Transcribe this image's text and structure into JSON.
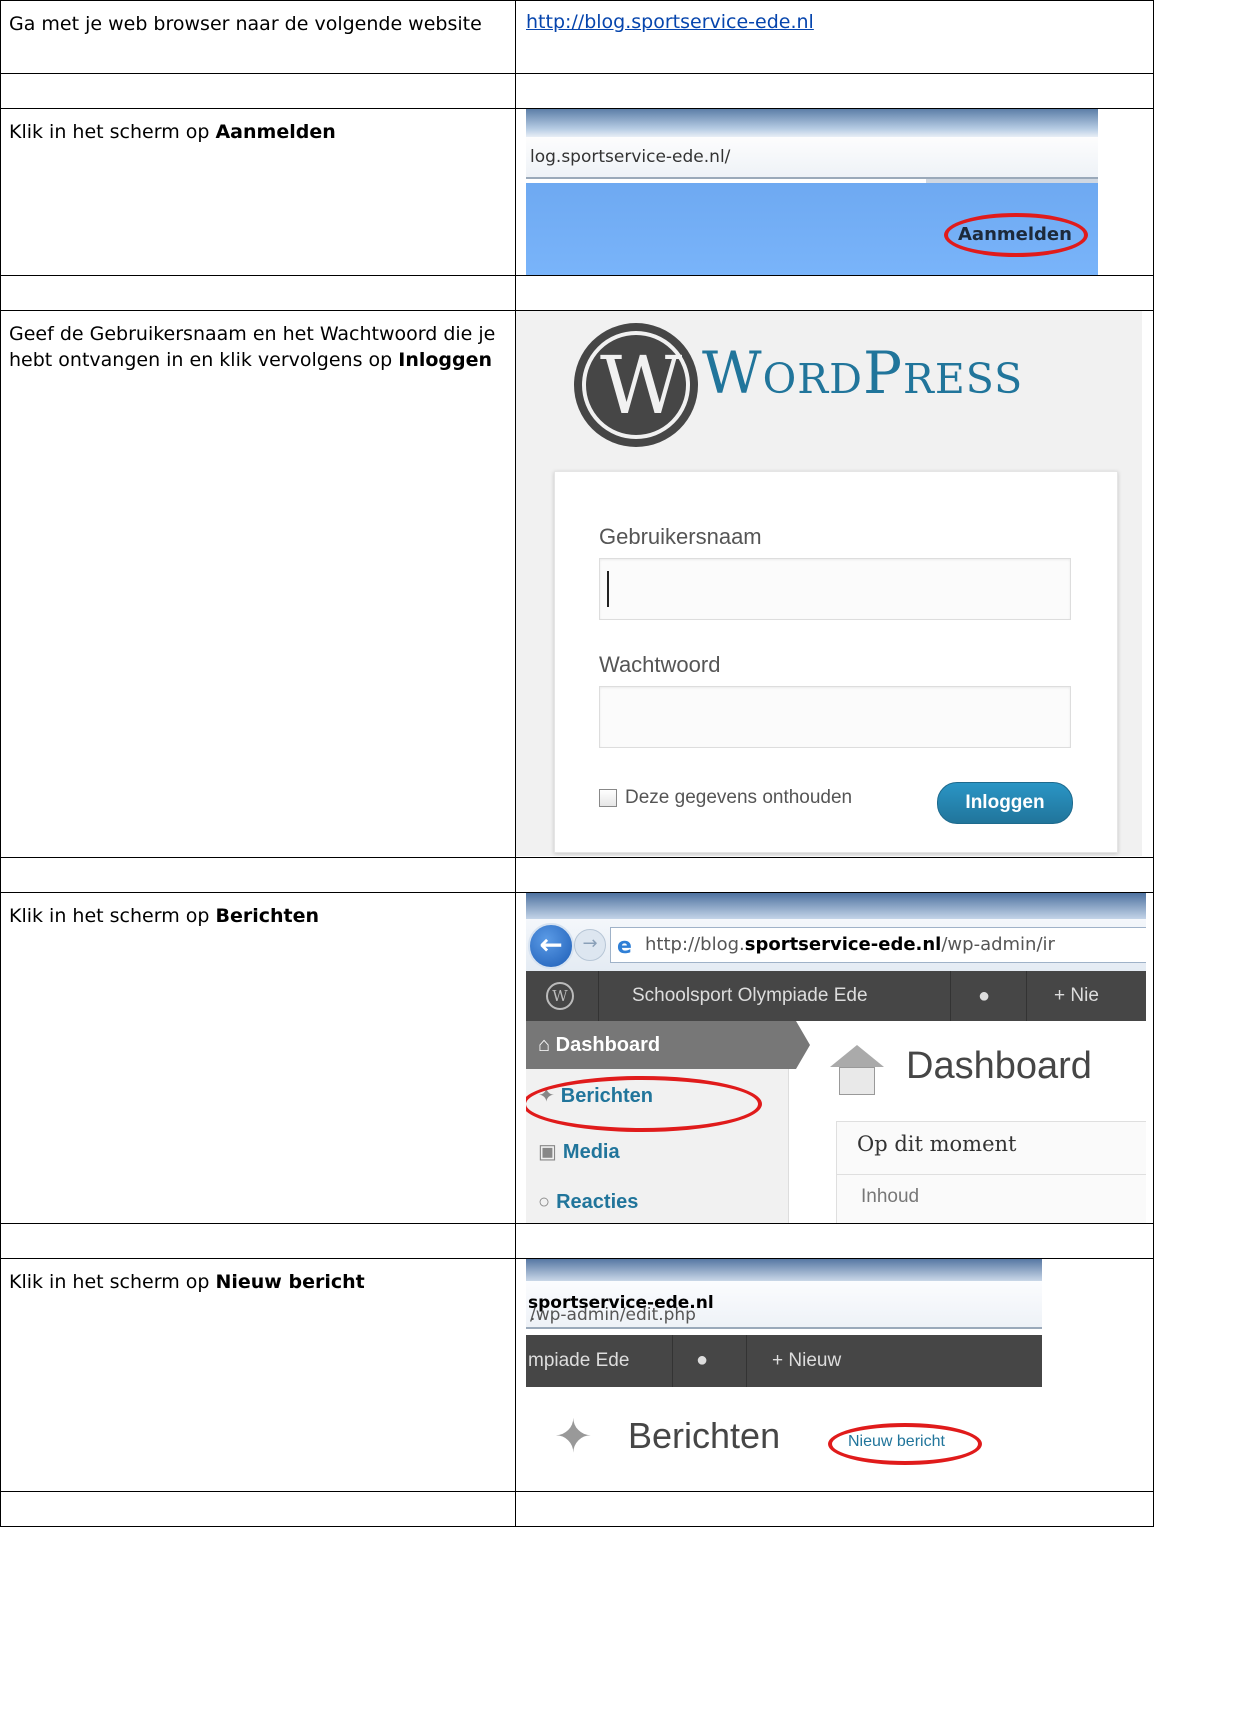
{
  "steps": [
    {
      "instruction_pre": "Ga met je web browser naar de volgende website",
      "link": "http://blog.sportservice-ede.nl"
    },
    {
      "instruction_pre": "Klik in het scherm op ",
      "instruction_bold": "Aanmelden",
      "screenshot": {
        "address_text": "log.sportservice-ede.nl/",
        "button_label": "Aanmelden"
      }
    },
    {
      "instruction_pre": "Geef de Gebruikersnaam en het Wachtwoord die je hebt ontvangen in en klik vervolgens op ",
      "instruction_bold": "Inloggen",
      "screenshot": {
        "logo_text": "WordPress",
        "username_label": "Gebruikersnaam",
        "password_label": "Wachtwoord",
        "remember_label": "Deze gegevens onthouden",
        "login_button": "Inloggen"
      }
    },
    {
      "instruction_pre": "Klik in het scherm op ",
      "instruction_bold": "Berichten",
      "screenshot": {
        "url_prefix": "http://blog.",
        "url_domain": "sportservice-ede.nl",
        "url_suffix": "/wp-admin/ir",
        "site_name": "Schoolsport Olympiade Ede",
        "new_label": "+ Nie",
        "menu_dashboard": "Dashboard",
        "menu_berichten": "Berichten",
        "menu_media": "Media",
        "menu_reacties": "Reacties",
        "page_title": "Dashboard",
        "widget_title": "Op dit moment",
        "widget_row": "Inhoud"
      }
    },
    {
      "instruction_pre": "Klik in het scherm op ",
      "instruction_bold": "Nieuw bericht",
      "screenshot": {
        "url_prefix": ".",
        "url_domain": "sportservice-ede.nl",
        "url_suffix": "/wp-admin/edit.php",
        "site_name": "mpiade Ede",
        "new_label": "+ Nieuw",
        "page_title": "Berichten",
        "new_post_button": "Nieuw bericht"
      }
    }
  ]
}
